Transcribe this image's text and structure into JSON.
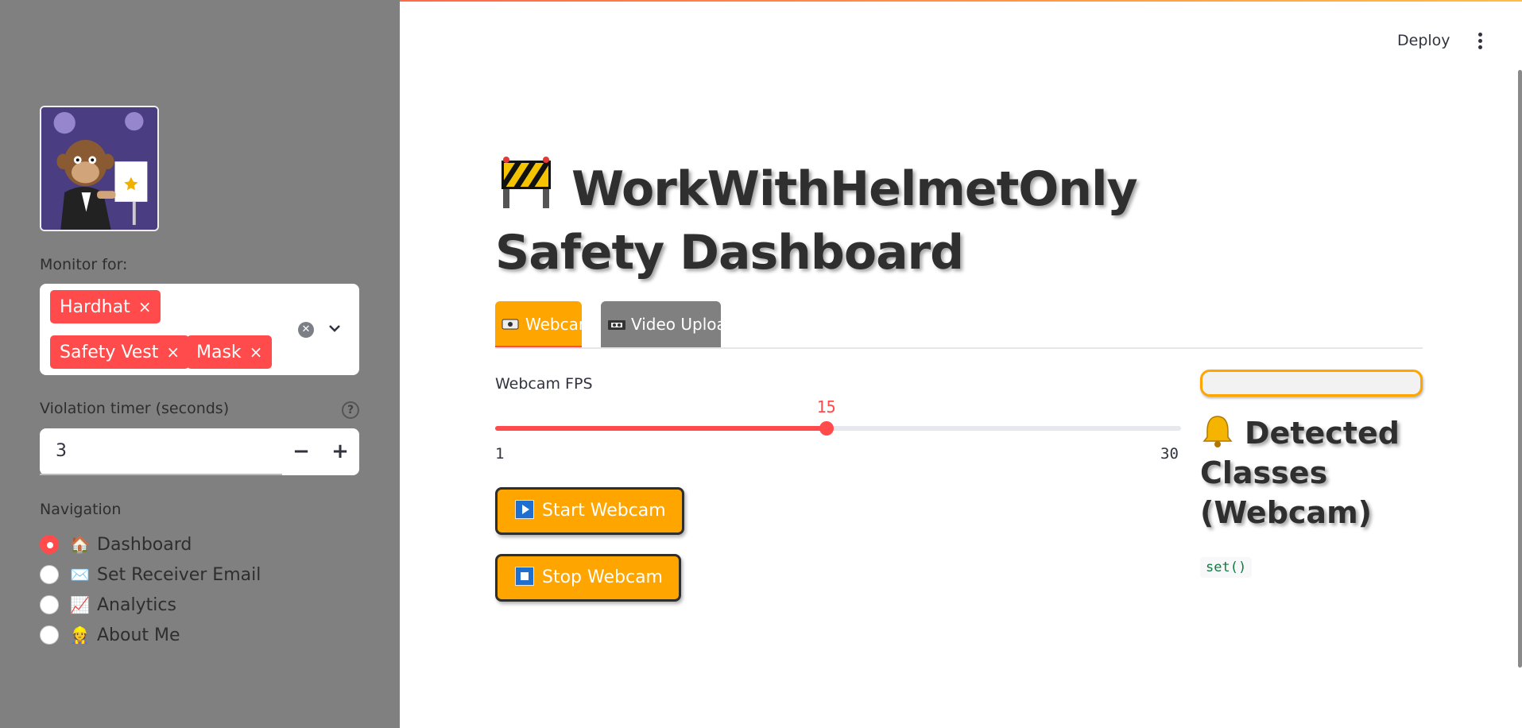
{
  "header": {
    "deploy_label": "Deploy",
    "menu_icon": "kebab-menu-icon"
  },
  "sidebar": {
    "avatar_icon": "profile-image",
    "monitor_label": "Monitor for:",
    "monitor_chips": [
      "Hardhat",
      "Safety Vest",
      "Mask"
    ],
    "chip_remove": "×",
    "timer_label": "Violation timer (seconds)",
    "timer_value": "3",
    "minus": "−",
    "plus": "+",
    "help": "?",
    "nav_label": "Navigation",
    "nav_items": [
      {
        "emoji": "🏠",
        "label": "Dashboard",
        "selected": true
      },
      {
        "emoji": "✉️",
        "label": "Set Receiver Email",
        "selected": false
      },
      {
        "emoji": "📈",
        "label": "Analytics",
        "selected": false
      },
      {
        "emoji": "👷",
        "label": "About Me",
        "selected": false
      }
    ]
  },
  "main": {
    "title": "WorkWithHelmetOnly Safety Dashboard",
    "tabs": [
      {
        "label": "Webcam",
        "active": true
      },
      {
        "label": "Video Upload",
        "active": false
      }
    ],
    "fps": {
      "label": "Webcam FPS",
      "value": 15,
      "min": 1,
      "max": 30,
      "value_text": "15",
      "min_text": "1",
      "max_text": "30"
    },
    "start_button": "Start Webcam",
    "stop_button": "Stop Webcam",
    "detected_title": "Detected Classes (Webcam)",
    "detected_value": "set()"
  },
  "colors": {
    "accent": "#ff4b4b",
    "orange": "#ffa500",
    "sidebar_bg": "#808080"
  }
}
